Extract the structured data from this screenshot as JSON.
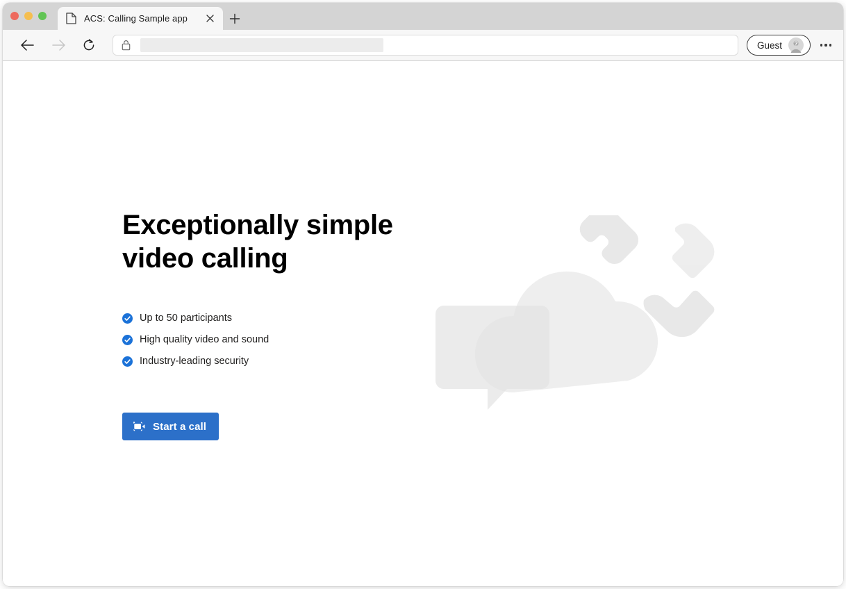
{
  "window": {
    "traffic_lights": [
      {
        "name": "close",
        "color": "#ED6A5E"
      },
      {
        "name": "minimize",
        "color": "#F5BE4F"
      },
      {
        "name": "maximize",
        "color": "#61C454"
      }
    ]
  },
  "tab": {
    "title": "ACS: Calling Sample app",
    "favicon": "page-icon",
    "close_icon": "close-icon",
    "new_tab_icon": "plus-icon"
  },
  "toolbar": {
    "back_icon": "arrow-left-icon",
    "forward_icon": "arrow-right-icon",
    "reload_icon": "reload-icon",
    "lock_icon": "lock-icon",
    "url_value": "",
    "url_placeholder": "",
    "profile_label": "Guest",
    "profile_avatar_icon": "person-question-avatar-icon",
    "more_icon": "more-horizontal-icon"
  },
  "main": {
    "heading": "Exceptionally simple\nvideo calling",
    "features": [
      {
        "icon": "check-circle-icon",
        "text": "Up to 50 participants"
      },
      {
        "icon": "check-circle-icon",
        "text": "High quality video and sound"
      },
      {
        "icon": "check-circle-icon",
        "text": "Industry-leading security"
      }
    ],
    "cta": {
      "label": "Start a call",
      "icon": "video-camera-icon",
      "color": "#2c70c9"
    },
    "illustration": {
      "name": "cloud-phone-chat-illustration",
      "parts": [
        "cloud-shape",
        "phone-handset-shape",
        "chat-bubble-shape"
      ],
      "color": "#e3e3e3"
    }
  },
  "colors": {
    "accent": "#2c70c9",
    "check": "#1b72d8",
    "text": "#201f1e",
    "illustration": "#e3e3e3"
  }
}
